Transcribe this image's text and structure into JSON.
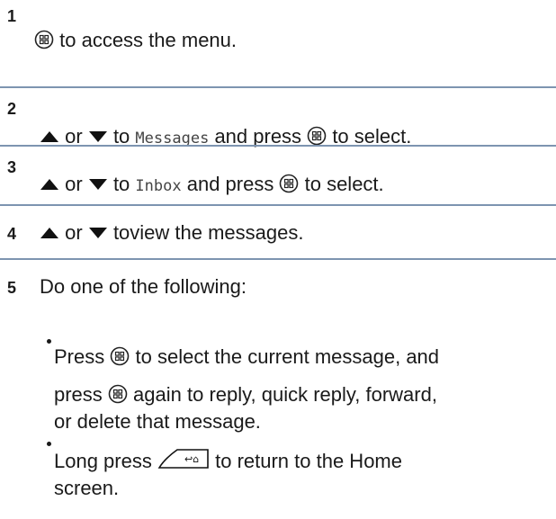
{
  "icons": {
    "menu": "menu-ok-button-icon",
    "up": "up-arrow-icon",
    "down": "down-arrow-icon",
    "back_home": "back-home-button-icon"
  },
  "steps": [
    {
      "number": "1",
      "text_a": "to access the menu."
    },
    {
      "number": "2",
      "or": "or",
      "to": "to",
      "target": "Messages",
      "text_b": "and press",
      "text_c": "to select."
    },
    {
      "number": "3",
      "or": "or",
      "to": "to",
      "target": "Inbox",
      "text_b": "and press",
      "text_c": "to select."
    },
    {
      "number": "4",
      "or": "or",
      "text_a": "toview the messages."
    },
    {
      "number": "5",
      "text_a": "Do one of the following:"
    }
  ],
  "bullets": [
    {
      "line1_a": "Press",
      "line1_b": "to select the current message, and",
      "line2_a": "press",
      "line2_b": "again to reply, quick reply, forward,",
      "line3": "or delete that message."
    },
    {
      "line1_a": "Long press",
      "line1_b": "to return to the Home",
      "line2": "screen."
    }
  ]
}
